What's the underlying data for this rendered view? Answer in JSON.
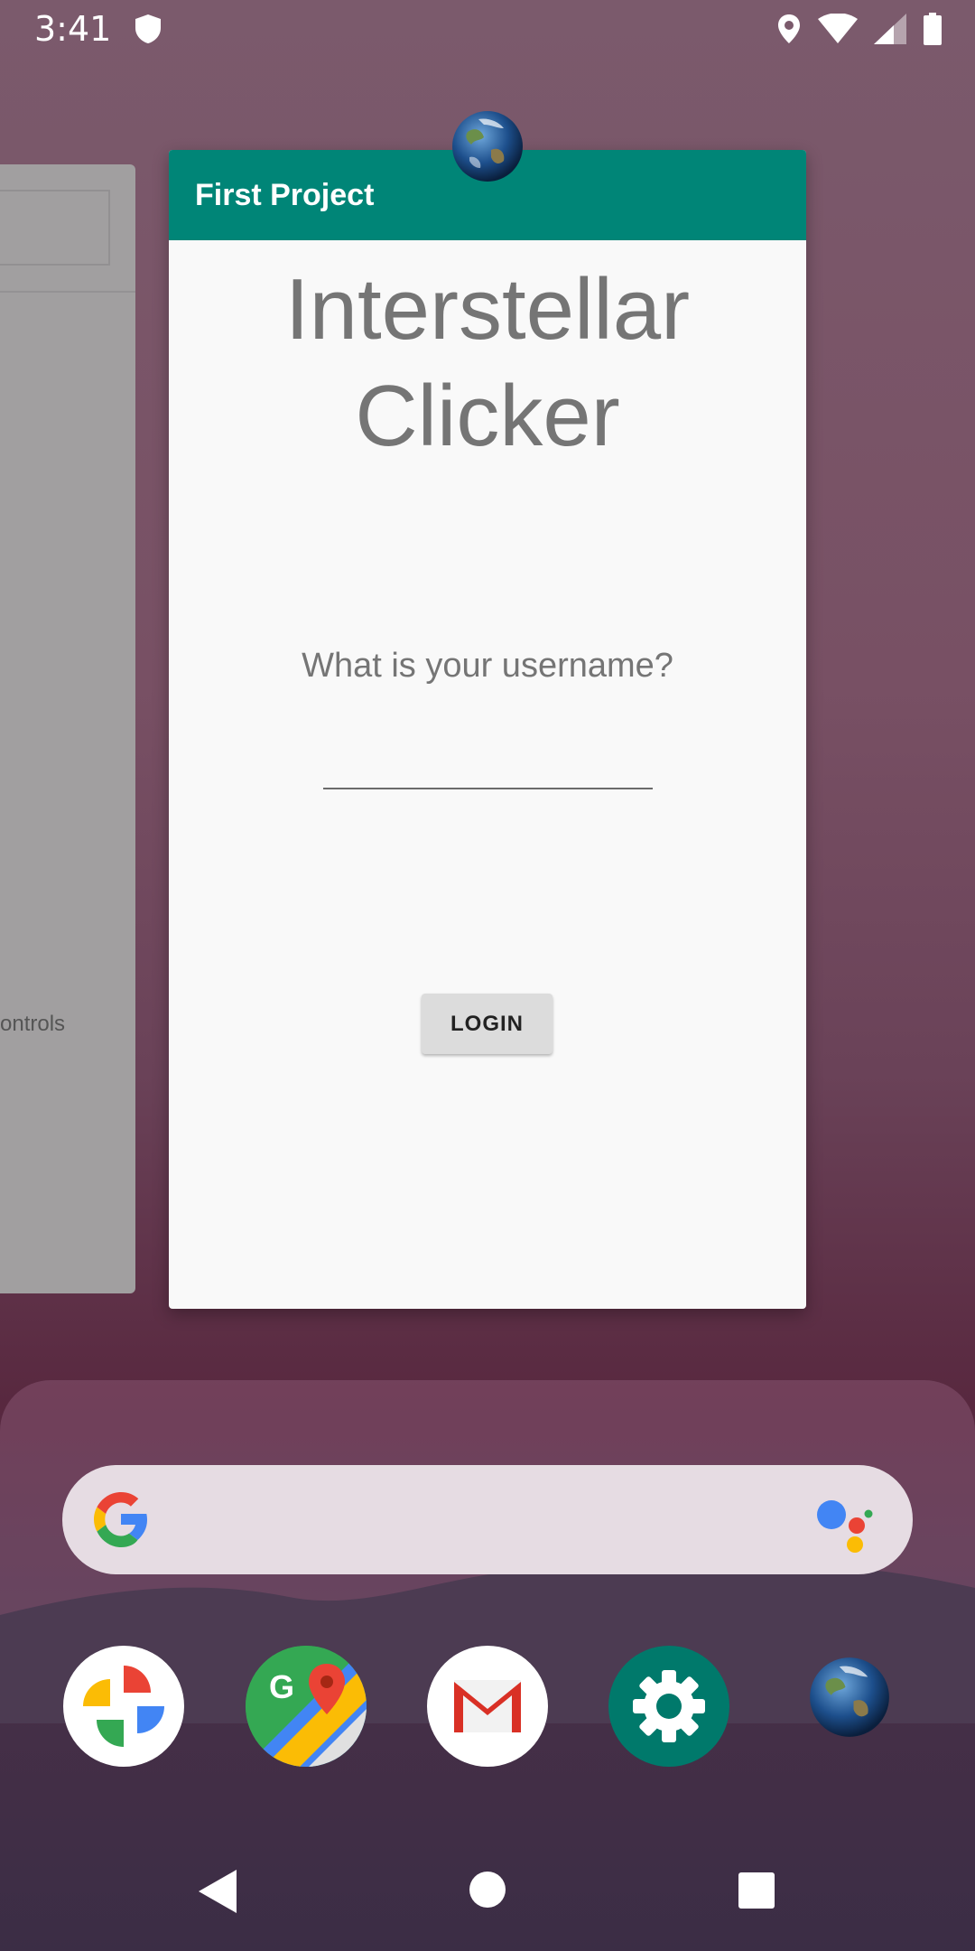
{
  "status_bar": {
    "time": "3:41",
    "icons": [
      "shield-icon",
      "location-icon",
      "wifi-icon",
      "signal-icon",
      "battery-icon"
    ]
  },
  "ghost_card": {
    "partial_text": "ontrols"
  },
  "recent_card": {
    "app_title": "First Project",
    "heading": "Interstellar Clicker",
    "question": "What is your username?",
    "username_value": "",
    "login_label": "LOGIN",
    "accent_color": "#008577"
  },
  "search": {
    "placeholder": ""
  },
  "dock_apps": [
    "Photos",
    "Maps",
    "Gmail",
    "Settings",
    "First Project"
  ],
  "nav": {
    "buttons": [
      "back",
      "home",
      "overview"
    ]
  }
}
